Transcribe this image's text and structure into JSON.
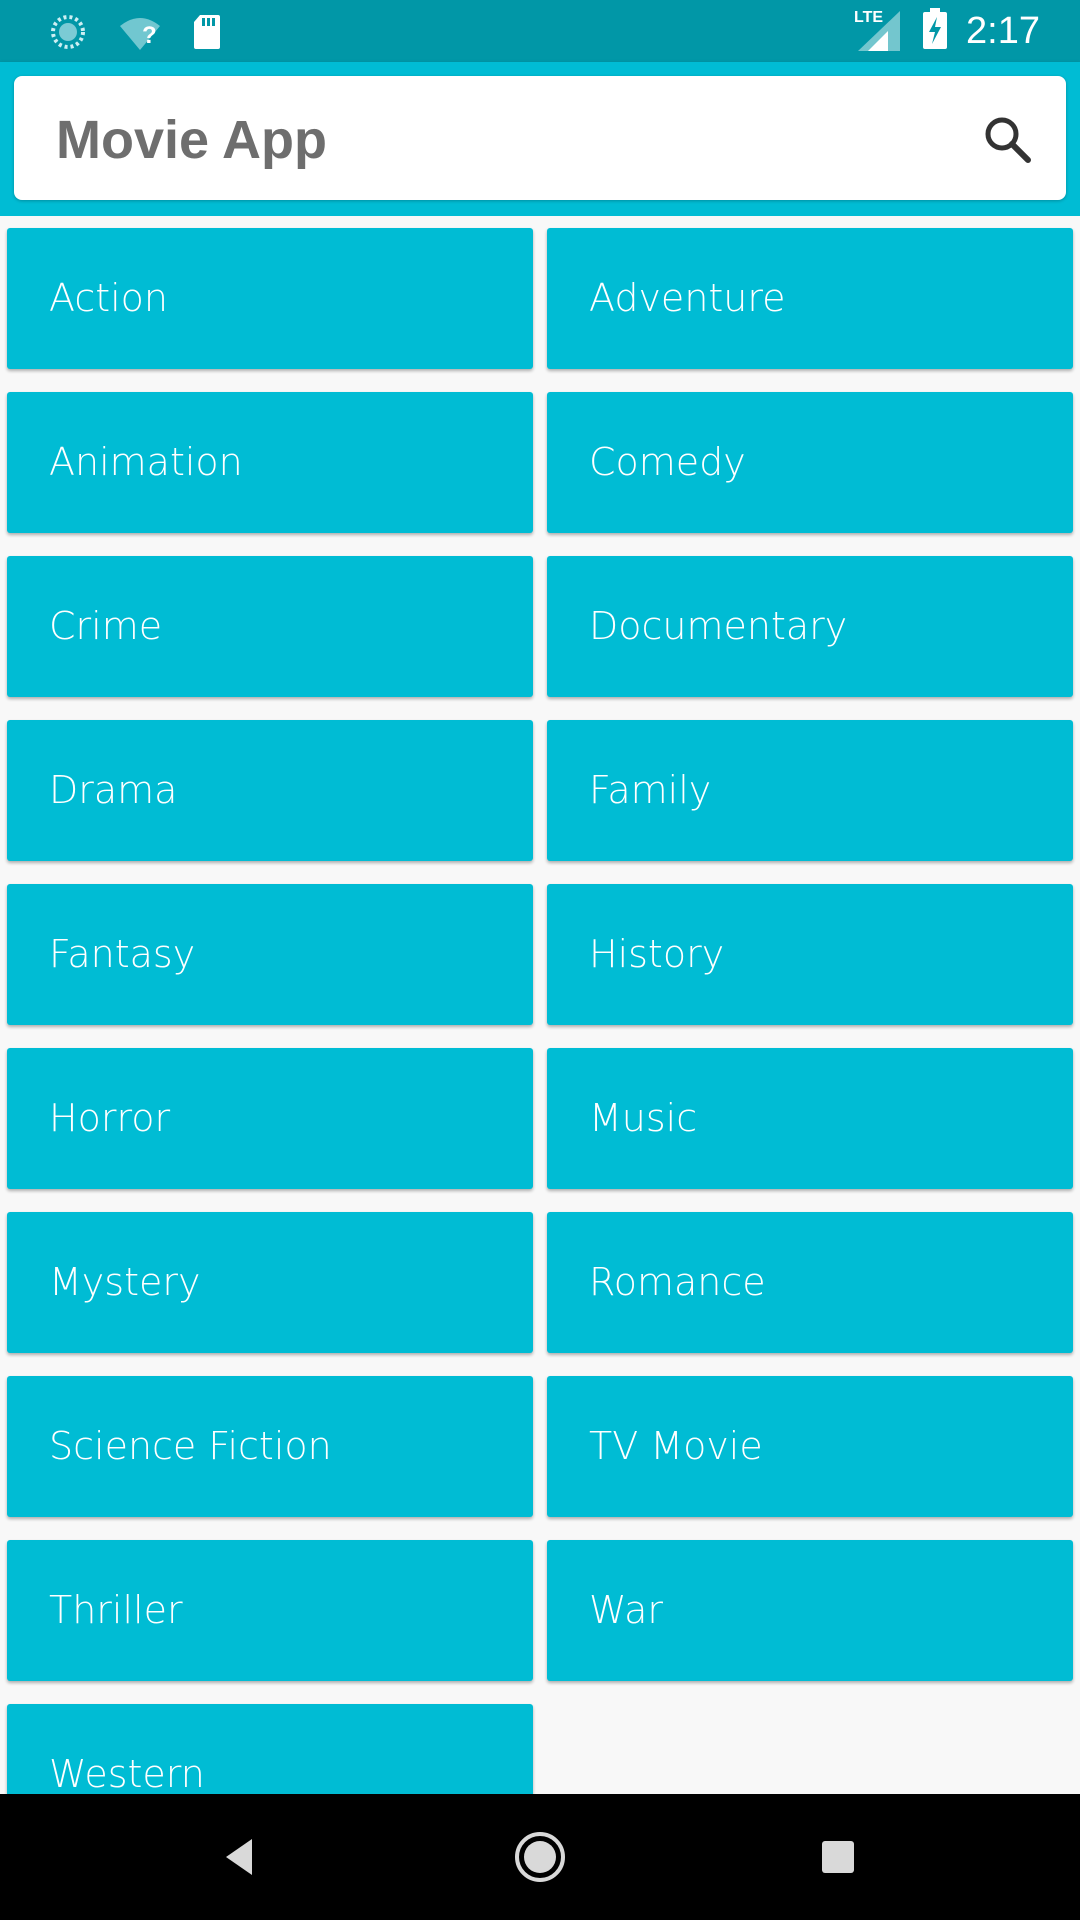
{
  "status_bar": {
    "time": "2:17",
    "icons": [
      "sync-icon",
      "wifi-unknown-icon",
      "sd-card-icon",
      "lte-signal-icon",
      "battery-charging-icon"
    ],
    "network_label": "LTE",
    "wifi_badge": "?"
  },
  "header": {
    "title": "Movie App",
    "search_icon": "search-icon"
  },
  "genres": [
    {
      "label": "Action"
    },
    {
      "label": "Adventure"
    },
    {
      "label": "Animation"
    },
    {
      "label": "Comedy"
    },
    {
      "label": "Crime"
    },
    {
      "label": "Documentary"
    },
    {
      "label": "Drama"
    },
    {
      "label": "Family"
    },
    {
      "label": "Fantasy"
    },
    {
      "label": "History"
    },
    {
      "label": "Horror"
    },
    {
      "label": "Music"
    },
    {
      "label": "Mystery"
    },
    {
      "label": "Romance"
    },
    {
      "label": "Science Fiction"
    },
    {
      "label": "TV Movie"
    },
    {
      "label": "Thriller"
    },
    {
      "label": "War"
    },
    {
      "label": "Western"
    }
  ],
  "nav_bar": {
    "icons": [
      "back-icon",
      "home-icon",
      "recents-icon"
    ]
  },
  "colors": {
    "status_bar": "#0197a7",
    "primary": "#00bcd4",
    "title_text": "#6e6e6e",
    "tile_text": "#ffffff"
  }
}
